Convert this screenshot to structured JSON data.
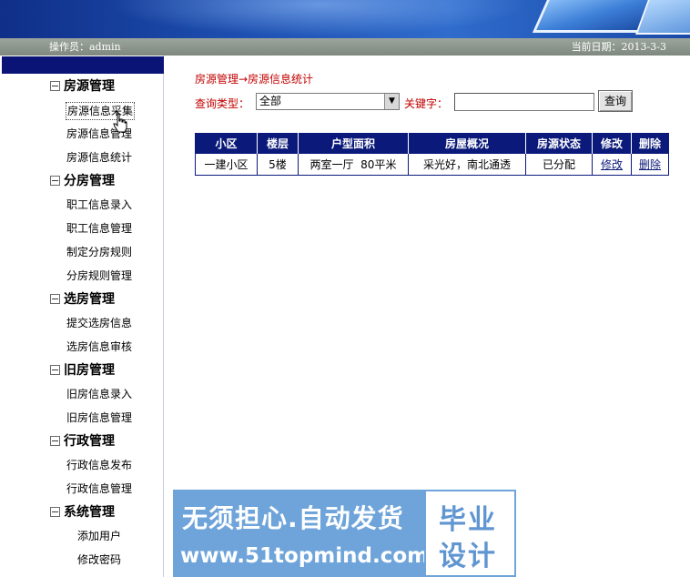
{
  "status": {
    "operator": "操作员：admin",
    "date": "当前日期：2013-3-3"
  },
  "sidebar": {
    "groups": [
      {
        "title": "房源管理",
        "items": [
          "房源信息采集",
          "房源信息管理",
          "房源信息统计"
        ]
      },
      {
        "title": "分房管理",
        "items": [
          "职工信息录入",
          "职工信息管理",
          "制定分房规则",
          "分房规则管理"
        ]
      },
      {
        "title": "选房管理",
        "items": [
          "提交选房信息",
          "选房信息审核"
        ]
      },
      {
        "title": "旧房管理",
        "items": [
          "旧房信息录入",
          "旧房信息管理"
        ]
      },
      {
        "title": "行政管理",
        "items": [
          "行政信息发布",
          "行政信息管理"
        ]
      },
      {
        "title": "系统管理",
        "items": [
          "添加用户",
          "修改密码"
        ]
      }
    ],
    "active_item": "房源信息采集"
  },
  "main": {
    "breadcrumb": "房源管理→房源信息统计",
    "query": {
      "type_label": "查询类型：",
      "type_value": "全部",
      "keyword_label": "关键字：",
      "keyword_value": "",
      "button_label": "查询"
    },
    "table": {
      "headers": [
        "小区",
        "楼层",
        "户型面积",
        "房屋概况",
        "房源状态",
        "修改",
        "删除"
      ],
      "rows": [
        [
          "一建小区",
          "5楼",
          "两室一厅  80平米",
          "采光好，南北通透",
          "已分配",
          "修改",
          "删除"
        ]
      ]
    }
  },
  "watermark": {
    "line1": "无须担心.自动发货",
    "line2": "www.51topmind.com",
    "right_top": "毕业",
    "right_bottom": "设计"
  },
  "colors": {
    "header_navy": "#0b1a7a",
    "label_red": "#c20000",
    "status_bar_gray": "#8a938a",
    "watermark_blue": "#6ea4da"
  }
}
